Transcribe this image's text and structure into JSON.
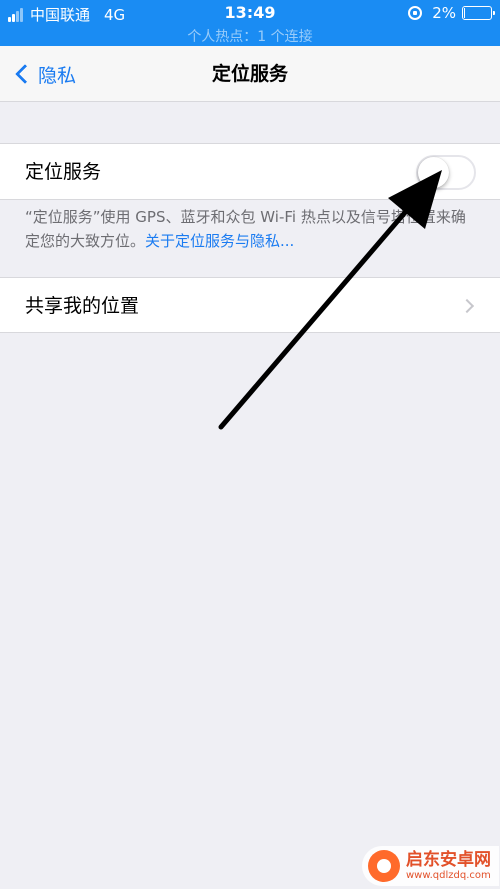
{
  "status_bar": {
    "carrier": "中国联通",
    "network": "4G",
    "time": "13:49",
    "battery_percent": "2%",
    "battery_level": 0.02,
    "hotspot_text": "个人热点：1 个连接"
  },
  "nav": {
    "back_label": "隐私",
    "title": "定位服务"
  },
  "location_services": {
    "label": "定位服务",
    "enabled": false
  },
  "footnote": {
    "text": "“定位服务”使用 GPS、蓝牙和众包 Wi-Fi 热点以及信号塔位置来确定您的大致方位。",
    "link": "关于定位服务与隐私..."
  },
  "share_location": {
    "label": "共享我的位置"
  },
  "watermark": {
    "name": "启东安卓网",
    "url": "www.qdlzdq.com"
  },
  "colors": {
    "status_bar": "#1a8cf3",
    "accent": "#1a7bf1",
    "background": "#efeff4"
  }
}
